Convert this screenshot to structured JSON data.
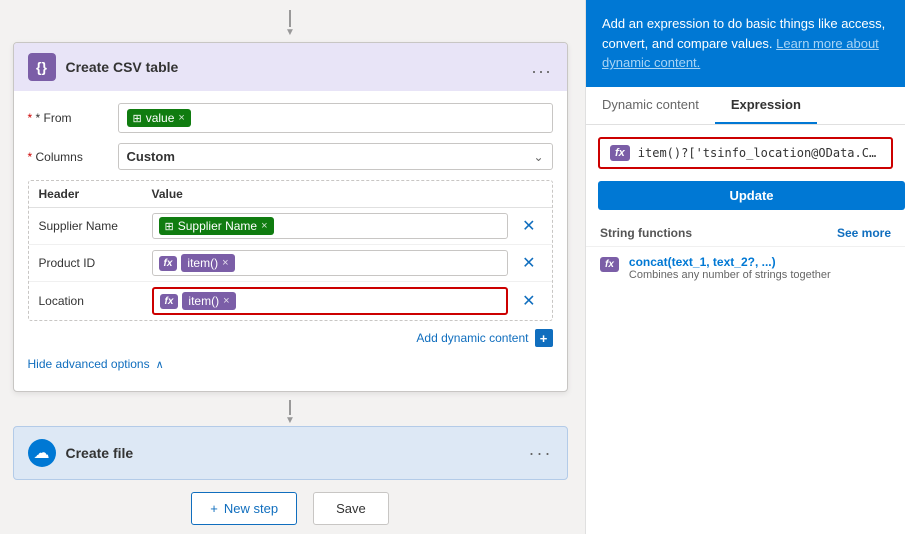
{
  "arrows": {
    "down": "▼"
  },
  "card_csv": {
    "icon": "{}",
    "title": "Create CSV table",
    "menu": "...",
    "from_label": "* From",
    "from_token": "value",
    "from_token_close": "×",
    "columns_label": "* Columns",
    "columns_value": "Custom",
    "table_headers": {
      "header_col": "Header",
      "value_col": "Value"
    },
    "rows": [
      {
        "header": "Supplier Name",
        "value_token_label": "Supplier Name",
        "value_token_type": "green",
        "value_token_close": "×",
        "fx": false
      },
      {
        "header": "Product ID",
        "value_token_label": "item()",
        "value_token_type": "purple",
        "value_token_close": "×",
        "fx": true
      },
      {
        "header": "Location",
        "value_token_label": "item()",
        "value_token_type": "purple",
        "value_token_close": "×",
        "fx": true,
        "active": true
      }
    ],
    "add_dynamic": "Add dynamic content",
    "hide_advanced": "Hide advanced options"
  },
  "card_file": {
    "title": "Create file"
  },
  "buttons": {
    "new_step_icon": "+",
    "new_step": "New step",
    "save": "Save"
  },
  "right_panel": {
    "header_text": "Add an expression to do basic things like access, convert, and compare values.",
    "learn_more": "Learn more about dynamic content.",
    "tab_dynamic": "Dynamic content",
    "tab_expression": "Expression",
    "expression_value": "item()?['tsinfo_location@OData.Communi",
    "update_btn": "Update",
    "string_functions": "String functions",
    "see_more": "See more",
    "func1_name": "concat(text_1, text_2?, ...)",
    "func1_desc": "Combines any number of strings together"
  }
}
